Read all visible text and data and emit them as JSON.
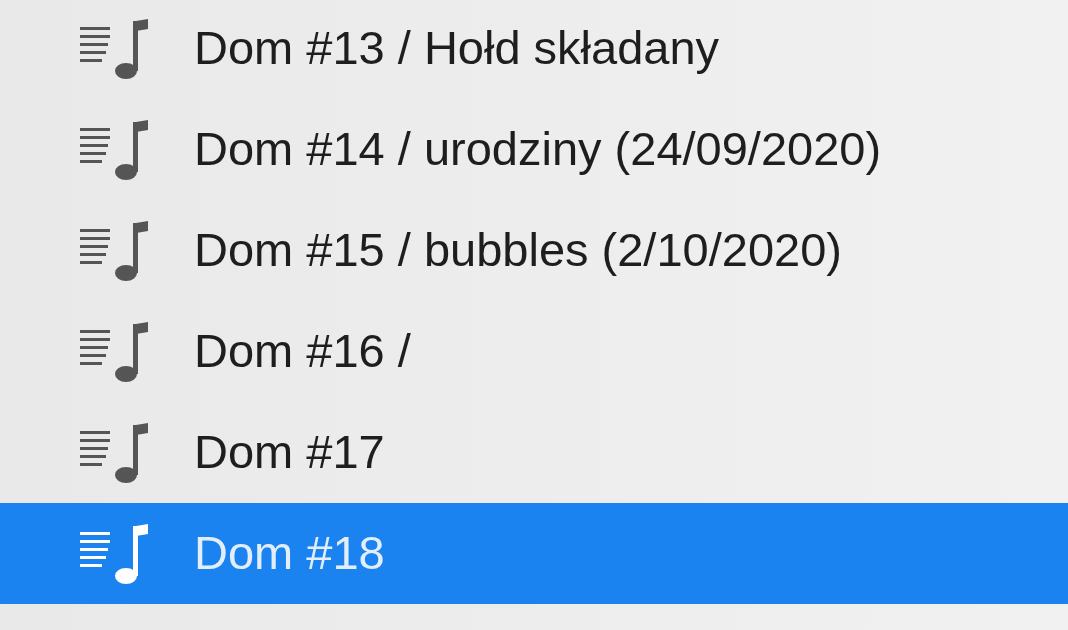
{
  "playlists": [
    {
      "name": "Dom #13 / Hołd składany",
      "selected": false
    },
    {
      "name": "Dom #14 / urodziny (24/09/2020)",
      "selected": false
    },
    {
      "name": "Dom #15 / bubbles (2/10/2020)",
      "selected": false
    },
    {
      "name": "Dom #16 /",
      "selected": false
    },
    {
      "name": "Dom #17",
      "selected": false
    },
    {
      "name": "Dom #18",
      "selected": true
    }
  ]
}
